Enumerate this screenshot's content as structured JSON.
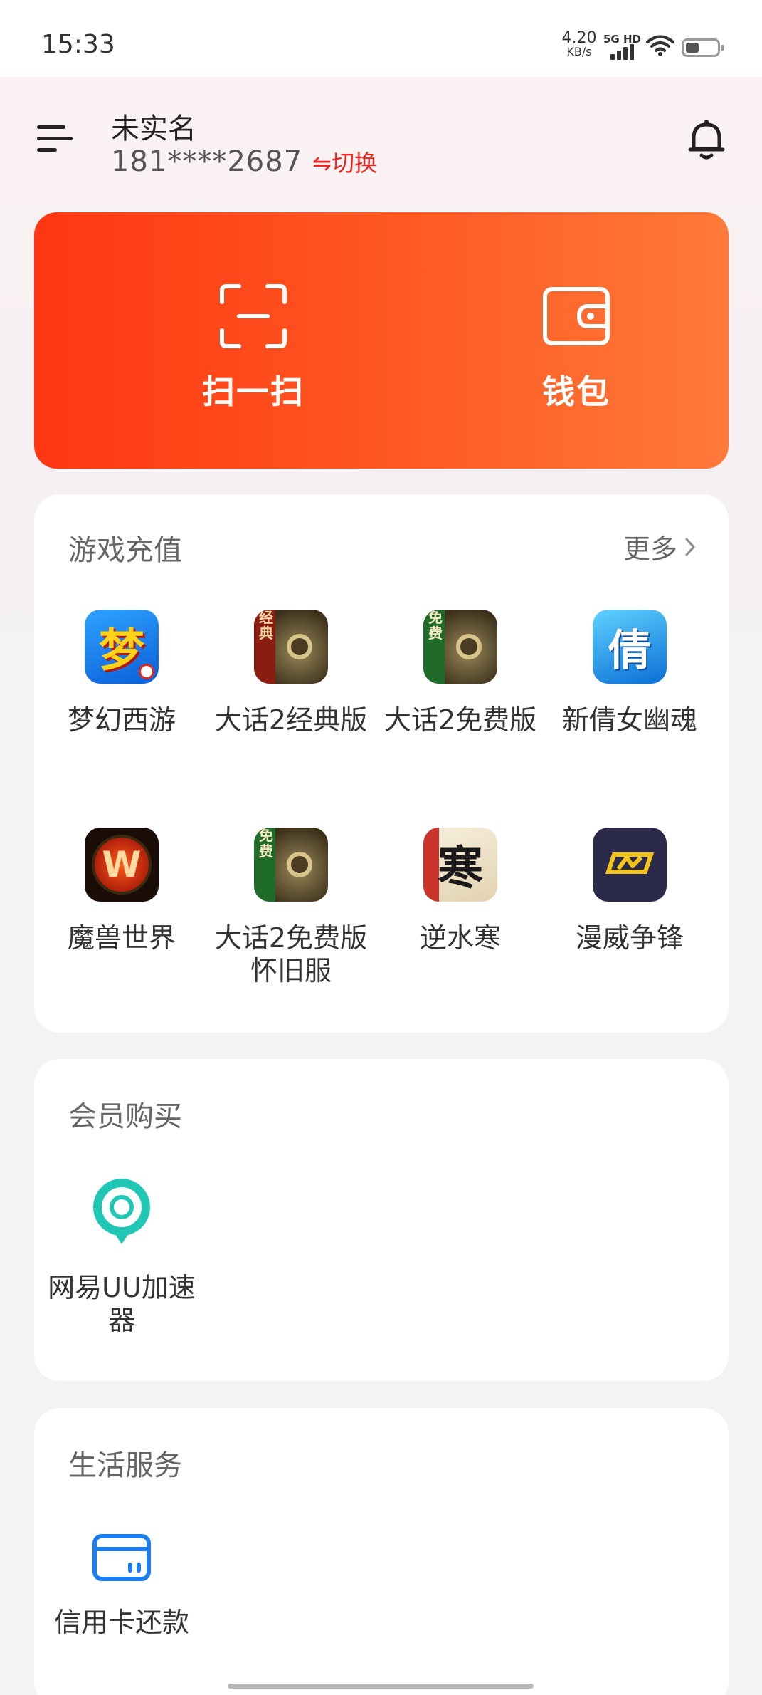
{
  "status_bar": {
    "time": "15:33",
    "net_speed_value": "4.20",
    "net_speed_unit": "KB/s",
    "network": "5G HD",
    "icons": [
      "signal-icon",
      "wifi-icon",
      "battery-icon"
    ]
  },
  "header": {
    "user_name": "未实名",
    "phone": "181****2687",
    "switch_label": "⇋切换",
    "icons": [
      "menu-icon",
      "bell-icon"
    ]
  },
  "hero": {
    "scan_label": "扫一扫",
    "wallet_label": "钱包",
    "icons": [
      "scan-icon",
      "wallet-icon"
    ],
    "colors": {
      "from": "#ff3612",
      "to": "#ff7a3a"
    }
  },
  "games": {
    "title": "游戏充值",
    "more_label": "更多",
    "items": [
      {
        "name": "梦幻西游",
        "icon": "menghuanxiyou-app-icon"
      },
      {
        "name": "大话2经典版",
        "icon": "dahua2-classic-app-icon"
      },
      {
        "name": "大话2免费版",
        "icon": "dahua2-free-app-icon"
      },
      {
        "name": "新倩女幽魂",
        "icon": "xinqiannv-app-icon"
      },
      {
        "name": "魔兽世界",
        "icon": "warcraft-app-icon"
      },
      {
        "name": "大话2免费版怀旧服",
        "icon": "dahua2-free-nostalgia-app-icon"
      },
      {
        "name": "逆水寒",
        "icon": "nishuihan-app-icon"
      },
      {
        "name": "漫威争锋",
        "icon": "marvel-rivals-app-icon"
      }
    ]
  },
  "membership": {
    "title": "会员购买",
    "items": [
      {
        "name": "网易UU加速器",
        "icon": "uu-accelerator-icon"
      }
    ]
  },
  "life": {
    "title": "生活服务",
    "items": [
      {
        "name": "信用卡还款",
        "icon": "credit-card-icon"
      }
    ]
  }
}
